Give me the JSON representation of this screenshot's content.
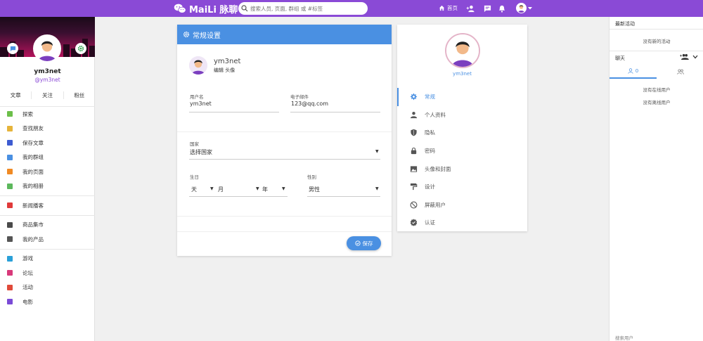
{
  "topbar": {
    "brand": "MaiLi 脉聊",
    "search_placeholder": "搜索人员, 页面, 群组 或 #标签",
    "home_label": "首页"
  },
  "profile": {
    "name": "ym3net",
    "handle": "@ym3net",
    "stats": [
      "文章",
      "关注",
      "粉丝"
    ]
  },
  "sidebar": {
    "groups": [
      [
        {
          "label": "探索",
          "color": "#6cbf4a"
        },
        {
          "label": "查找朋友",
          "color": "#e6b43a"
        },
        {
          "label": "保存文章",
          "color": "#3d5bd1"
        },
        {
          "label": "我的群组",
          "color": "#4a90e2"
        },
        {
          "label": "我的页面",
          "color": "#f08a24"
        },
        {
          "label": "我的相册",
          "color": "#5cb85c"
        }
      ],
      [
        {
          "label": "新闻播客",
          "color": "#e03a3a"
        }
      ],
      [
        {
          "label": "商品集市",
          "color": "#4a4a4a"
        },
        {
          "label": "我的产品",
          "color": "#555555"
        }
      ],
      [
        {
          "label": "游戏",
          "color": "#2aa0d8"
        },
        {
          "label": "论坛",
          "color": "#d8397a"
        },
        {
          "label": "活动",
          "color": "#e04a3a"
        },
        {
          "label": "电影",
          "color": "#7a4ad6"
        }
      ]
    ]
  },
  "form": {
    "title": "常规设置",
    "user_name": "ym3net",
    "edit_avatar": "编辑 头像",
    "username_label": "用户名",
    "username_value": "ym3net",
    "email_label": "电子邮件",
    "email_value": "123@qq.com",
    "country_label": "国家",
    "country_value": "选择国家",
    "birthday_label": "生日",
    "day_value": "天",
    "month_value": "月",
    "year_value": "年",
    "gender_label": "性别",
    "gender_value": "男性",
    "save_label": "保存"
  },
  "settings_menu": {
    "name": "ym3net",
    "items": [
      "常规",
      "个人资料",
      "隐私",
      "密码",
      "头像和封面",
      "设计",
      "屏蔽用户",
      "认证"
    ],
    "active_index": 0
  },
  "right_panel": {
    "activity_title": "最新活动",
    "no_activity": "没有新的活动",
    "chat_title": "聊天",
    "online_count": "0",
    "no_online": "没有在线用户",
    "no_offline": "没有离线用户",
    "search_users": "搜索用户"
  },
  "colors": {
    "brand": "#8a4ad6",
    "accent": "#4a90e2"
  }
}
